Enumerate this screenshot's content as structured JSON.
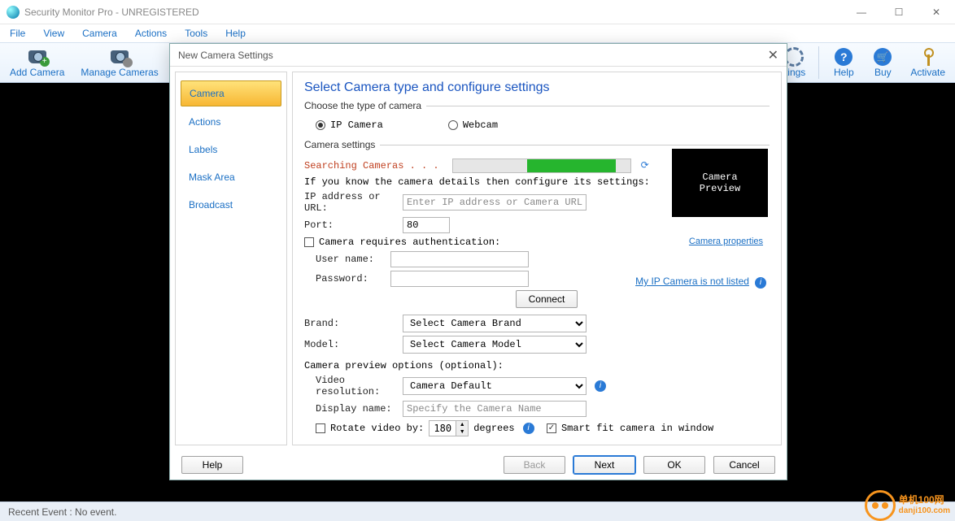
{
  "window": {
    "title": "Security Monitor Pro - UNREGISTERED"
  },
  "menu": {
    "items": [
      "File",
      "View",
      "Camera",
      "Actions",
      "Tools",
      "Help"
    ]
  },
  "toolbar": {
    "add_camera": "Add Camera",
    "manage_cameras": "Manage Cameras",
    "settings_suffix": "ttings",
    "help": "Help",
    "buy": "Buy",
    "activate": "Activate"
  },
  "status": {
    "recent": "Recent Event : No event."
  },
  "dialog": {
    "title": "New Camera Settings",
    "sidebar": [
      "Camera",
      "Actions",
      "Labels",
      "Mask Area",
      "Broadcast"
    ],
    "heading": "Select Camera type and configure settings",
    "group_type": "Choose the type of camera",
    "radio_ip": "IP Camera",
    "radio_web": "Webcam",
    "group_settings": "Camera settings",
    "search": "Searching Cameras . . .",
    "hint": "If you know the camera details then configure its settings:",
    "ip_lbl": "IP address or URL:",
    "ip_ph": "Enter IP address or Camera URL",
    "port_lbl": "Port:",
    "port_val": "80",
    "auth_lbl": "Camera requires authentication:",
    "user_lbl": "User name:",
    "pass_lbl": "Password:",
    "connect": "Connect",
    "brand_lbl": "Brand:",
    "brand_sel": "Select Camera Brand",
    "model_lbl": "Model:",
    "model_sel": "Select Camera Model",
    "prev_opts": "Camera preview options (optional):",
    "vres_lbl": "Video resolution:",
    "vres_sel": "Camera Default",
    "dname_lbl": "Display name:",
    "dname_ph": "Specify the Camera Name",
    "rotate_lbl": "Rotate video by:",
    "rotate_val": "180",
    "degrees": "degrees",
    "smartfit": "Smart fit camera in window",
    "preview_text": "Camera\nPreview",
    "cam_props": "Camera properties",
    "not_listed": "My IP Camera is not listed",
    "help_btn": "Help",
    "back": "Back",
    "next": "Next",
    "ok": "OK",
    "cancel": "Cancel"
  },
  "watermark": {
    "main": "单机100网",
    "sub": "danji100.com"
  }
}
